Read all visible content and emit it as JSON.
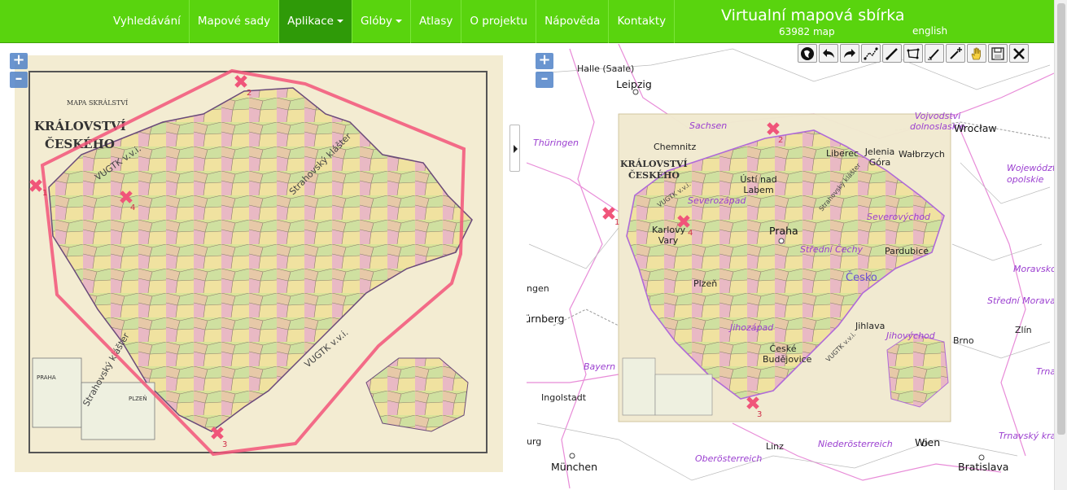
{
  "nav": {
    "items": [
      {
        "label": "Vyhledávání",
        "active": false,
        "dropdown": false
      },
      {
        "label": "Mapové sady",
        "active": false,
        "dropdown": false
      },
      {
        "label": "Aplikace",
        "active": true,
        "dropdown": true
      },
      {
        "label": "Glóby",
        "active": false,
        "dropdown": true
      },
      {
        "label": "Atlasy",
        "active": false,
        "dropdown": false
      },
      {
        "label": "O projektu",
        "active": false,
        "dropdown": false
      },
      {
        "label": "Nápověda",
        "active": false,
        "dropdown": false
      },
      {
        "label": "Kontakty",
        "active": false,
        "dropdown": false
      }
    ]
  },
  "header": {
    "title": "Virtualní mapová sbírka",
    "count": "63982 map",
    "language": "english"
  },
  "colors": {
    "topbar": "#59d40e",
    "active_nav": "#2f9a08",
    "polygon": "#f2557a",
    "marker": "#f0557a",
    "boundary": "#d98ce8"
  },
  "left_map": {
    "zoom_in": "+",
    "zoom_out": "–",
    "title_small": "MAPA SKRÁLSTVÍ",
    "title_main_1": "KRÁLOVSTVÍ",
    "title_main_2": "ČESKÉHO",
    "inset_labels": [
      "PRAHA",
      "PLZEŇ"
    ],
    "watermarks": [
      "VUGTK v.v.i.",
      "Strahovský klášter",
      "Strahovský klášter",
      "VUGTK v.v.i."
    ],
    "control_points": [
      "1",
      "2",
      "3",
      "4"
    ]
  },
  "right_map": {
    "zoom_in": "+",
    "zoom_out": "–",
    "overlay_title_1": "KRÁLOVSTVÍ",
    "overlay_title_2": "ČESKÉHO",
    "watermarks": [
      "VUGTK v.v.i.",
      "Strahovský klášter",
      "VUGTK v.v.i."
    ],
    "control_points": [
      "1",
      "2",
      "3",
      "4"
    ],
    "labels": {
      "halle": "Halle (Saale)",
      "leipzig": "Leipzig",
      "sachsen": "Sachsen",
      "chemnitz": "Chemnitz",
      "thuringen": "Thüringen",
      "vojevodstvi_dolno": "Vojvodstvi dolnoslaskie",
      "wroclaw": "Wrocław",
      "liberec": "Liberec",
      "jelenia": "Jelenia Góra",
      "walbrzych": "Wałbrzych",
      "wojewodztwo": "Województ opolskie",
      "usti": "Ústí nad Labem",
      "karlovy": "Karlovy Vary",
      "severovych": "Severovýchod",
      "severozapad": "Severozápad",
      "praha": "Praha",
      "stredni_cechy": "Střední Čechy",
      "pardubice": "Pardubice",
      "cesko": "Česko",
      "moravsko": "Moravsko",
      "stredni_morava": "Střední Morava",
      "norimberk": "Nürnberg",
      "plzen": "Plzeň",
      "jihozapad": "Jihozápad",
      "jihlava": "Jihlava",
      "jihovychod": "Jihovýchod",
      "brno": "Brno",
      "zlin": "Zlín",
      "bayern": "Bayern",
      "ingolstadt": "Ingolstadt",
      "ceske_budejovice": "České Budějovice",
      "trnava": "Trnava",
      "linz": "Linz",
      "niederosterreich": "Niederösterreich",
      "wien": "Wien",
      "oberosterreich": "Oberösterreich",
      "munchen": "München",
      "bratislava": "Bratislava",
      "trnavsky": "Trnavský kraj",
      "ngen": "ngen",
      "urg": "urg"
    }
  },
  "toolbar": {
    "tools": [
      "globe-icon",
      "undo-icon",
      "redo-icon",
      "polyline-icon",
      "line-icon",
      "rectangle-icon",
      "edit-point-icon",
      "add-point-icon",
      "pan-hand-icon",
      "save-icon",
      "close-icon"
    ]
  }
}
